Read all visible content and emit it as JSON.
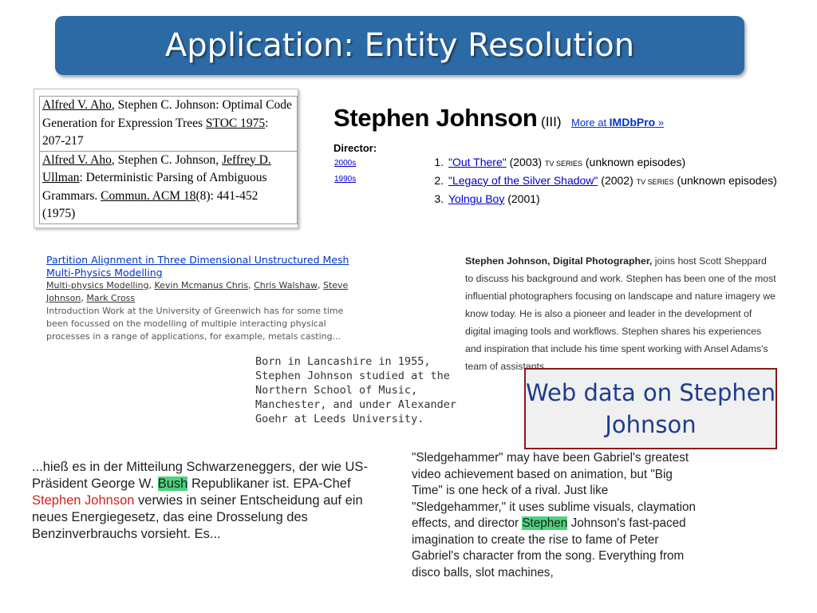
{
  "slide": {
    "title": "Application: Entity Resolution",
    "callout": "Web data on Stephen Johnson"
  },
  "dblp": {
    "entry1": {
      "author1": "Alfred V. Aho",
      "sep1": ", Stephen C. Johnson: Optimal Code Generation for Expression Trees ",
      "venue": "STOC 1975",
      "pages": ": 207-217"
    },
    "entry2": {
      "author1": "Alfred V. Aho",
      "sep1": ", Stephen C. Johnson, ",
      "author3": "Jeffrey D. Ullman",
      "title": ": Deterministic Parsing of Ambiguous Grammars. ",
      "venue": "Commun. ACM 18",
      "pages": "(8): 441-452 (1975)"
    }
  },
  "imdb": {
    "name": "Stephen Johnson",
    "roman": "(III)",
    "pro_prefix": "More at ",
    "pro_brand": "IMDbPro",
    "pro_suffix": " »",
    "director_label": "Director:",
    "decades": [
      "2000s",
      "1990s"
    ],
    "credits": [
      {
        "num": "1.",
        "title": "\"Out There\"",
        "year": " (2003) ",
        "tag": "TV series",
        "extra": " (unknown episodes)"
      },
      {
        "num": "2.",
        "title": "\"Legacy of the Silver Shadow\"",
        "year": " (2002) ",
        "tag": "TV series",
        "extra": " (unknown episodes)"
      },
      {
        "num": "3.",
        "title": "Yolngu Boy",
        "year": " (2001)",
        "tag": "",
        "extra": ""
      }
    ]
  },
  "paper": {
    "title": "Partition Alignment in Three Dimensional Unstructured Mesh Multi-Physics Modelling",
    "authors": [
      "Multi-physics Modelling",
      "Kevin Mcmanus Chris",
      "Chris Walshaw",
      "Steve Johnson",
      "Mark Cross"
    ],
    "author_sep": ", ",
    "abstract": "Introduction Work at the University of Greenwich has for some time been focussed on the modelling of multiple interacting physical processes in a range of applications, for example, metals casting..."
  },
  "photographer": {
    "bold": "Stephen Johnson, Digital Photographer,",
    "text": " joins host Scott Sheppard to discuss his background and work. Stephen has been one of the most influential photographers focusing on landscape and nature imagery we know today. He is also a pioneer and leader in the development of digital imaging tools and workflows. Stephen shares his experiences and inspiration that include his time spent working with Ansel Adams's team of assistants."
  },
  "composer": {
    "text": "Born in Lancashire in 1955, Stephen Johnson studied at the Northern School of Music, Manchester, and under Alexander Goehr at Leeds University."
  },
  "german": {
    "p1": "...hieß es in der Mitteilung Schwarzeneggers, der wie US-Präsident George W. ",
    "hl": "Bush",
    "p2": " Republikaner ist. EPA-Chef ",
    "red": "Stephen Johnson",
    "p3": " verwies in seiner Entscheidung auf ein neues Energiegesetz, das eine Drosselung des Benzinverbrauchs vorsieht. Es..."
  },
  "review": {
    "p1": "\"Sledgehammer\" may have been Gabriel's greatest video achievement based on animation, but \"Big Time\" is one heck of a rival. Just like \"Sledgehammer,\" it uses sublime visuals, claymation effects, and director ",
    "hl": "Stephen",
    "p2": " Johnson's fast-paced imagination to create the rise to fame of Peter Gabriel's character from the song. Everything from disco balls, slot machines,"
  },
  "colors": {
    "title_bar": "#2c6aa5",
    "callout_border": "#8b1a1a",
    "callout_text": "#1e3c8c",
    "highlight": "#4cd37c",
    "red_name": "#d61f1f"
  }
}
